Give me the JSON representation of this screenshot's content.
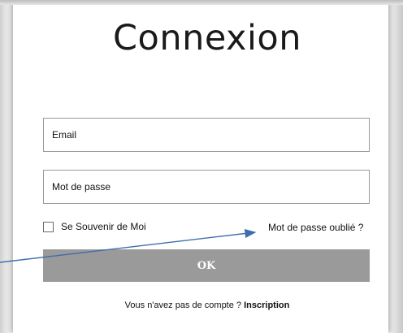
{
  "login": {
    "title": "Connexion",
    "email_placeholder": "Email",
    "password_placeholder": "Mot de passe",
    "remember_label": "Se Souvenir de Moi",
    "remember_checked": false,
    "forgot_label": "Mot de passe oublié ?",
    "ok_label": "OK",
    "no_account_text": "Vous n'avez pas de compte ?",
    "signup_label": "Inscription"
  },
  "colors": {
    "button_bg": "#9a9a9a",
    "annotation_arrow": "#3d6fae"
  },
  "icons": {
    "annotation": "arrow-icon"
  }
}
